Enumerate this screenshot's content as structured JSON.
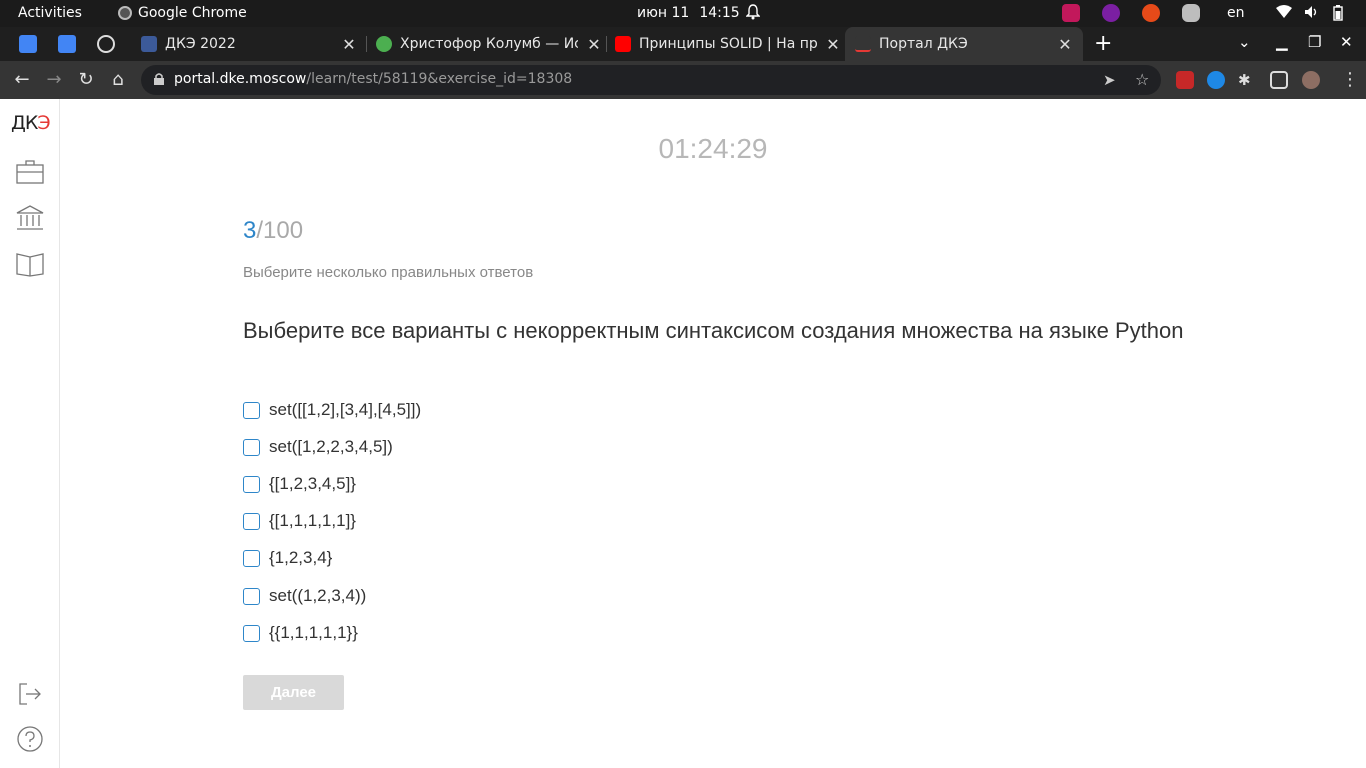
{
  "system_bar": {
    "activities": "Activities",
    "app_name": "Google Chrome",
    "date": "июн 11",
    "time": "14:15",
    "lang": "en"
  },
  "tabs": [
    {
      "title": "ДКЭ 2022",
      "favicon": "dke-favicon",
      "color": "#3c5a99"
    },
    {
      "title": "Христофор Колумб — Ис",
      "favicon": "green-circle-favicon",
      "color": "#4caf50"
    },
    {
      "title": "Принципы SOLID | На при",
      "favicon": "youtube-favicon",
      "color": "#ff0000"
    },
    {
      "title": "Портал ДКЭ",
      "favicon": "dke-favicon",
      "color": "#e53935"
    }
  ],
  "address_bar": {
    "host": "portal.dke.moscow",
    "path": "/learn/test/58119&exercise_id=18308"
  },
  "sidebar": {
    "logo_left": "ДК",
    "logo_right": "Э",
    "items": [
      "briefcase-icon",
      "library-icon",
      "book-icon"
    ],
    "bottom_items": [
      "logout-icon",
      "help-icon"
    ]
  },
  "test": {
    "timer": "01:24:29",
    "current": "3",
    "total": "/100",
    "hint": "Выберите несколько правильных ответов",
    "question": "Выберите все варианты с некорректным синтаксисом создания множества на языке Python",
    "options": [
      "set([[1,2],[3,4],[4,5]])",
      "set([1,2,2,3,4,5])",
      "{[1,2,3,4,5]}",
      "{[1,1,1,1,1]}",
      "{1,2,3,4}",
      "set((1,2,3,4))",
      "{{1,1,1,1,1}}"
    ],
    "next_label": "Далее"
  },
  "colors": {
    "accent": "#2e86c9",
    "logo_red": "#e53935"
  }
}
